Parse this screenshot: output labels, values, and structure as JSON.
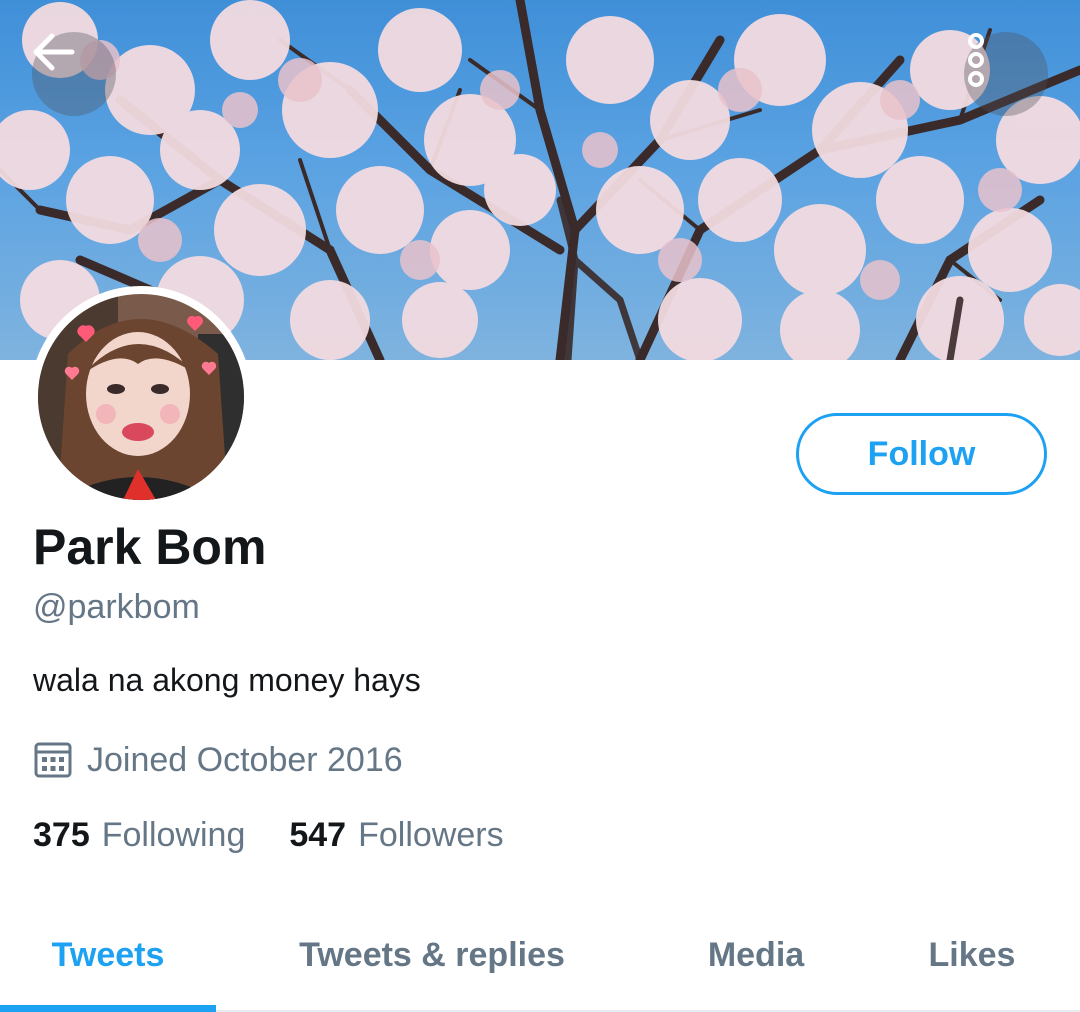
{
  "header": {
    "back_icon": "arrow-left-icon",
    "more_icon": "vertical-ellipsis-icon"
  },
  "profile": {
    "display_name": "Park Bom",
    "handle": "@parkbom",
    "bio": "wala na akong money hays",
    "joined": "Joined October 2016",
    "follow_label": "Follow",
    "following_count": "375",
    "following_label": "Following",
    "followers_count": "547",
    "followers_label": "Followers"
  },
  "tabs": [
    {
      "label": "Tweets",
      "active": true
    },
    {
      "label": "Tweets & replies",
      "active": false
    },
    {
      "label": "Media",
      "active": false
    },
    {
      "label": "Likes",
      "active": false
    }
  ],
  "colors": {
    "accent": "#1da1f2",
    "text_primary": "#14171a",
    "text_secondary": "#657786",
    "divider": "#e6ecf0"
  }
}
